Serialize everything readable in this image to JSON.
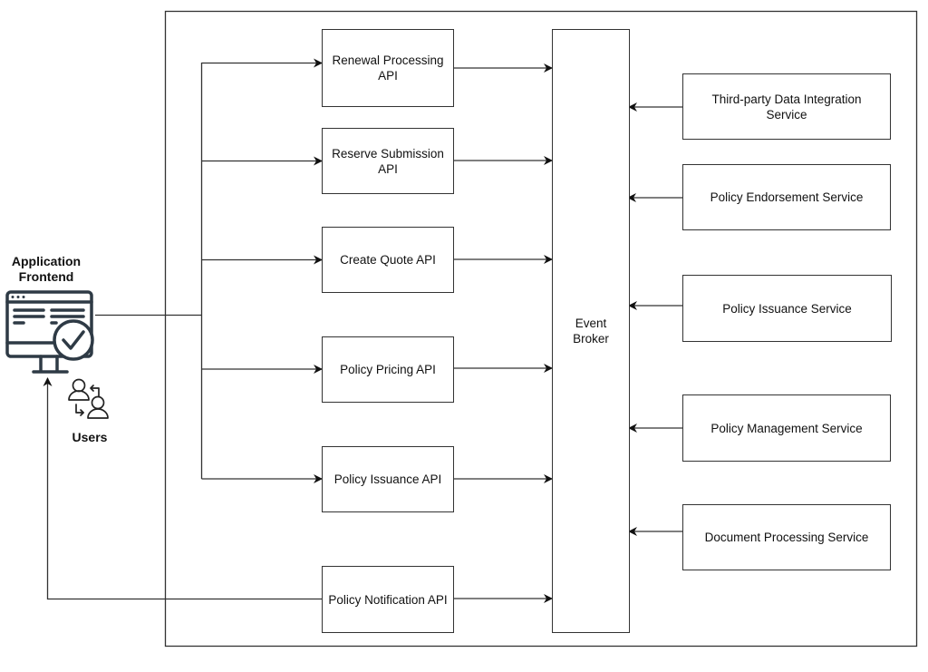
{
  "diagram": {
    "frontend": {
      "label_line1": "Application",
      "label_line2": "Frontend",
      "icon": "web-app-check-icon"
    },
    "users": {
      "label": "Users",
      "icon": "users-exchange-icon"
    },
    "apis": [
      {
        "id": "renewal",
        "line1": "Renewal Processing",
        "line2": "API"
      },
      {
        "id": "reserve",
        "line1": "Reserve Submission",
        "line2": "API"
      },
      {
        "id": "quote",
        "line1": "Create Quote API",
        "line2": ""
      },
      {
        "id": "pricing",
        "line1": "Policy Pricing API",
        "line2": ""
      },
      {
        "id": "issuance",
        "line1": "Policy Issuance API",
        "line2": ""
      },
      {
        "id": "notification",
        "line1": "Policy Notification API",
        "line2": ""
      }
    ],
    "broker": {
      "line1": "Event",
      "line2": "Broker"
    },
    "services": [
      {
        "id": "thirdparty",
        "line1": "Third-party Data Integration",
        "line2": "Service"
      },
      {
        "id": "endorsement",
        "line1": "Policy Endorsement Service",
        "line2": ""
      },
      {
        "id": "issuance-svc",
        "line1": "Policy Issuance Service",
        "line2": ""
      },
      {
        "id": "management",
        "line1": "Policy Management Service",
        "line2": ""
      },
      {
        "id": "document",
        "line1": "Document Processing Service",
        "line2": ""
      }
    ],
    "edges": [
      {
        "from": "frontend",
        "to": "renewal"
      },
      {
        "from": "frontend",
        "to": "reserve"
      },
      {
        "from": "frontend",
        "to": "quote"
      },
      {
        "from": "frontend",
        "to": "pricing"
      },
      {
        "from": "frontend",
        "to": "issuance"
      },
      {
        "from": "renewal",
        "to": "broker"
      },
      {
        "from": "reserve",
        "to": "broker"
      },
      {
        "from": "quote",
        "to": "broker"
      },
      {
        "from": "pricing",
        "to": "broker"
      },
      {
        "from": "issuance",
        "to": "broker"
      },
      {
        "from": "notification",
        "to": "broker"
      },
      {
        "from": "notification",
        "to": "frontend"
      },
      {
        "from": "thirdparty",
        "to": "broker"
      },
      {
        "from": "endorsement",
        "to": "broker"
      },
      {
        "from": "issuance-svc",
        "to": "broker"
      },
      {
        "from": "management",
        "to": "broker"
      },
      {
        "from": "document",
        "to": "broker"
      }
    ],
    "colors": {
      "stroke": "#333333",
      "icon": "#2e3a45"
    }
  }
}
